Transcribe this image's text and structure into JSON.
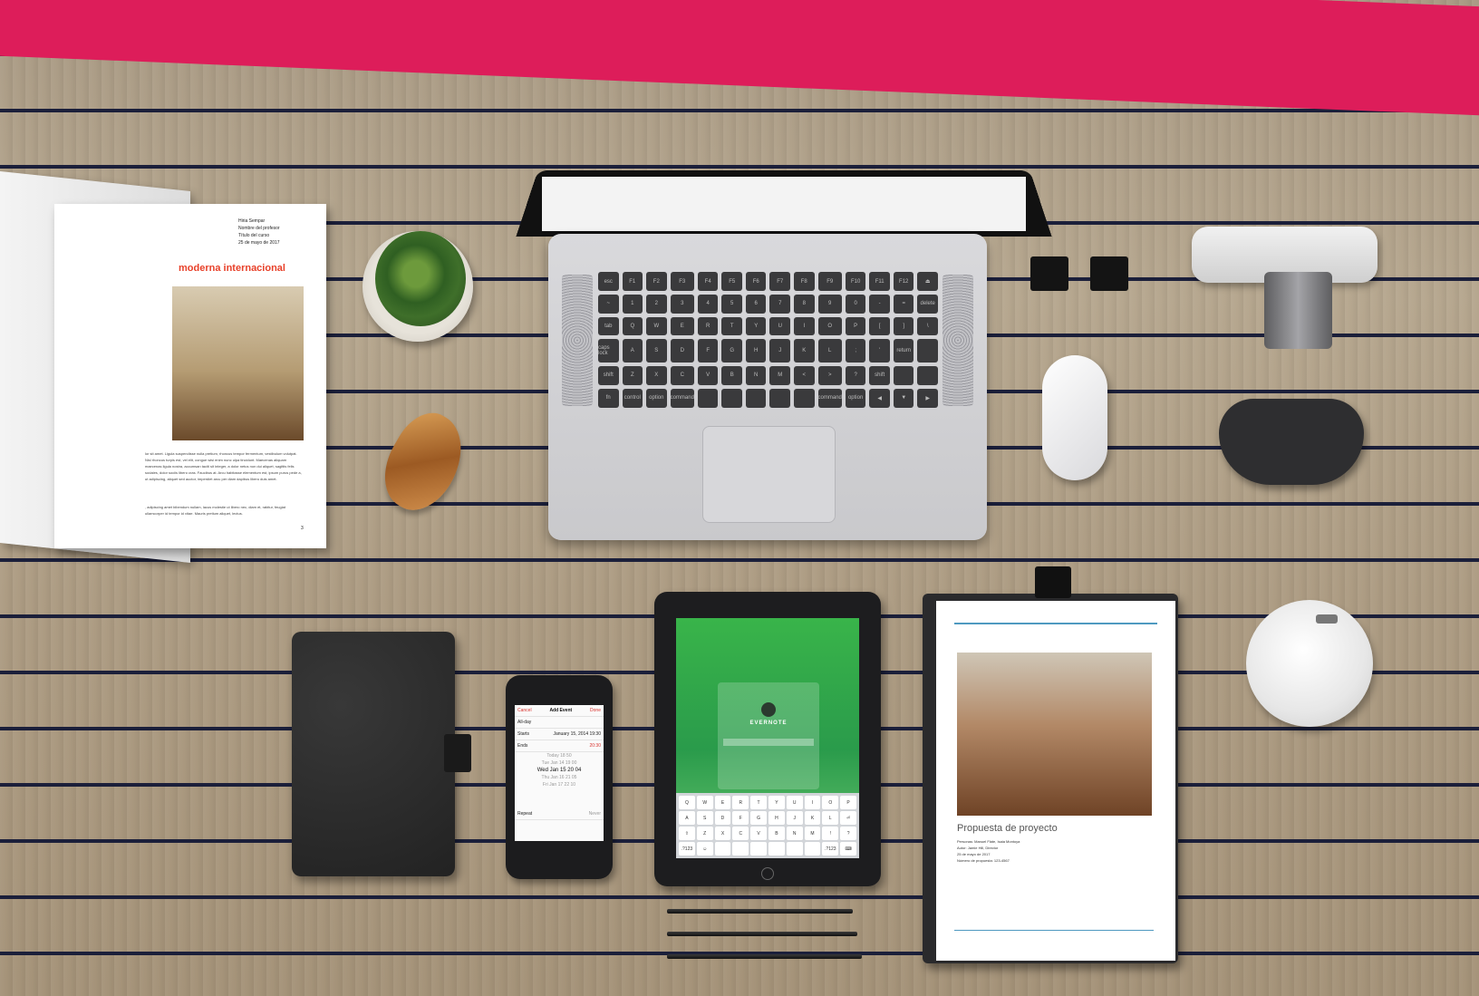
{
  "scene": {
    "background_color": "#ad9c83",
    "accent_color": "#dd1d5a"
  },
  "magazine": {
    "meta_lines": [
      "Hiria Sempar",
      "Nombre del profesor",
      "Título del curso",
      "25 de mayo de 2017"
    ],
    "title": "moderna internacional",
    "body_text": "lor sit amet. Ligula suspendisse nulla pretium, rhoncus tempor fermentum, vestibulum volutpat. Nisl rhoncus turpis est, vel elit, congue wisi enim nunc ulpa tincidunt. Maecenas aliquam maecenas ligula nostra, accumsan taciti sit integer, a dolor netus non dui aliquet, sagittis felis sodales, dolor sociis libero cras. Faucibus at. Arcu habitasse elementum est, ipsum purus pede a, ut adipiscing, aliquet sed auctor, imperdiet arcu per diam dapibus libero duis amet.",
    "body_text_2": ", adipiscing amet bibendum nullam, lacus molestie ut libero nec, diam et, rabitur, feugiat ullamcorper id tempor id vitae. Mauris pretium aliquet, lectus.",
    "page_number": "3"
  },
  "iphone": {
    "header_left": "Cancel",
    "header_title": "Add Event",
    "header_right": "Done",
    "rows": [
      {
        "label": "All-day",
        "value": ""
      },
      {
        "label": "Starts",
        "value": "January 15, 2014   19:30"
      },
      {
        "label": "Ends",
        "value": "20:30"
      }
    ],
    "picker_rows": [
      "Today  18  50",
      "Tue Jan 14  19  00",
      "Wed Jan 15  20  04",
      "Thu Jan 16  21  05",
      "Fri Jan 17  22  10"
    ],
    "repeat_label": "Repeat",
    "repeat_value": "Never"
  },
  "ipad": {
    "app_name": "EVERNOTE"
  },
  "document": {
    "title": "Propuesta de proyecto",
    "meta_lines": [
      "Personas: Manuel Flate, Isaia Montoya",
      "Autor: Jamie Hill, Director",
      "25 de mayo de 2017",
      "Número de propuesta: 123-4567"
    ]
  },
  "laptop_keys": [
    "esc",
    "F1",
    "F2",
    "F3",
    "F4",
    "F5",
    "F6",
    "F7",
    "F8",
    "F9",
    "F10",
    "F11",
    "F12",
    "⏏",
    "~",
    "1",
    "2",
    "3",
    "4",
    "5",
    "6",
    "7",
    "8",
    "9",
    "0",
    "-",
    "=",
    "delete",
    "tab",
    "Q",
    "W",
    "E",
    "R",
    "T",
    "Y",
    "U",
    "I",
    "O",
    "P",
    "[",
    "]",
    "\\",
    "caps lock",
    "A",
    "S",
    "D",
    "F",
    "G",
    "H",
    "J",
    "K",
    "L",
    ";",
    "'",
    "return",
    "",
    "shift",
    "Z",
    "X",
    "C",
    "V",
    "B",
    "N",
    "M",
    "<",
    ">",
    "?",
    "shift",
    "",
    "",
    "fn",
    "control",
    "option",
    "command",
    "",
    "",
    "",
    "",
    "",
    "command",
    "option",
    "◀",
    "▼",
    "▶"
  ],
  "ipad_keys": [
    "Q",
    "W",
    "E",
    "R",
    "T",
    "Y",
    "U",
    "I",
    "O",
    "P",
    "A",
    "S",
    "D",
    "F",
    "G",
    "H",
    "J",
    "K",
    "L",
    "⏎",
    "⇧",
    "Z",
    "X",
    "C",
    "V",
    "B",
    "N",
    "M",
    "!",
    "?",
    ".?123",
    "☺",
    "",
    "",
    "",
    "",
    "",
    "",
    ".?123",
    "⌨"
  ]
}
